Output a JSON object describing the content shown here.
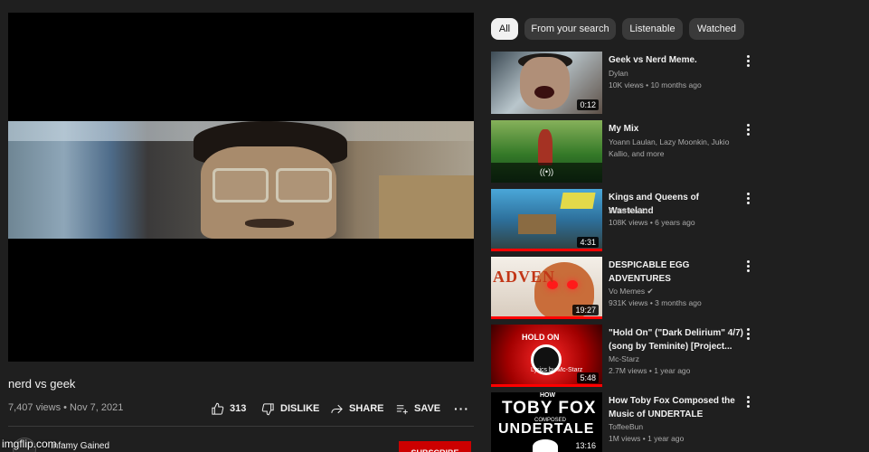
{
  "video": {
    "title": "nerd vs geek",
    "meta": "7,407 views • Nov 7, 2021",
    "likes": "313",
    "dislike_label": "DISLIKE",
    "share_label": "SHARE",
    "save_label": "SAVE",
    "channel": "Infamy Gained",
    "subscribe_label": "SUBSCRIBE"
  },
  "watermark": "imgflip.com",
  "chips": [
    "All",
    "From your search",
    "Listenable",
    "Watched"
  ],
  "recommendations": [
    {
      "title": "Geek vs Nerd Meme.",
      "channel": "Dylan",
      "stats": "10K views • 10 months ago",
      "duration": "0:12"
    },
    {
      "title": "My Mix",
      "channel": "Yoann Laulan, Lazy Moonkin, Jukio Kallio, and more",
      "stats": "",
      "duration": "",
      "live_icon": "((•))"
    },
    {
      "title": "Kings and Queens of Wasteland",
      "channel": "Jukio Kallio",
      "stats": "108K views • 6 years ago",
      "duration": "4:31",
      "progress": 1.0
    },
    {
      "title": "DESPICABLE EGG ADVENTURES",
      "channel": "Vo Memes",
      "stats": "931K views • 3 months ago",
      "duration": "19:27",
      "progress": 1.0,
      "thumb_text": "ADVEN"
    },
    {
      "title": "\"Hold On\" (\"Dark Delirium\" 4/7) (song by Teminite) [Project...",
      "channel": "Mc-Starz",
      "stats": "2.7M views • 1 year ago",
      "duration": "5:48",
      "progress": 1.0,
      "thumb_text": "HOLD ON",
      "thumb_sub": "Lyrics by Mc-Starz"
    },
    {
      "title": "How Toby Fox Composed the Music of UNDERTALE",
      "channel": "ToffeeBun",
      "stats": "1M views • 1 year ago",
      "duration": "13:16",
      "thumb_l1": "HOW",
      "thumb_l2": "TOBY FOX",
      "thumb_l3": "COMPOSED",
      "thumb_l4": "UNDERTALE"
    }
  ],
  "colors": {
    "background": "#1f1f1f",
    "accent": "#ff0000",
    "subscribe": "#cc0000"
  }
}
